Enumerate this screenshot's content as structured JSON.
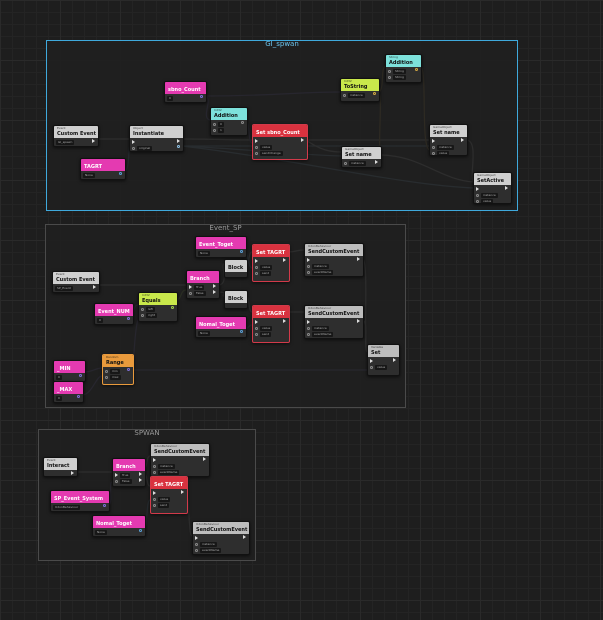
{
  "groups": {
    "gi_spwan": "GI_spwan",
    "event_sp": "Event_SP",
    "spwan": "SPWAN"
  },
  "nodes": {
    "g1_custom_event": {
      "title": "Custom Event",
      "field": "GI_spawn"
    },
    "g1_instantiate": {
      "title": "Instantiate"
    },
    "g1_tagrt": {
      "title": "TAGRT"
    },
    "g1_sbno_count": {
      "title": "sbno_Count"
    },
    "g1_addition_a": {
      "title": "Addition"
    },
    "g1_set_sbno_count": {
      "title": "Set sbno_Count"
    },
    "g1_tostring": {
      "title": "ToString"
    },
    "g1_addition_b": {
      "title": "Addition"
    },
    "g1_set_name_a": {
      "title": "Set name"
    },
    "g1_set_name_b": {
      "title": "Set name"
    },
    "g1_setactive": {
      "title": "SetActive"
    },
    "e_custom_event": {
      "title": "Custom Event",
      "field": "SP_Event"
    },
    "e_event_toget": {
      "title": "Event_Toget"
    },
    "e_set_tagrt_a": {
      "title": "Set TAGRT"
    },
    "e_send_custom_a": {
      "title": "SendCustomEvent"
    },
    "e_branch": {
      "title": "Branch"
    },
    "e_block_a": {
      "title": "Block"
    },
    "e_block_b": {
      "title": "Block"
    },
    "e_event_num": {
      "title": "Event_NUM"
    },
    "e_equals": {
      "title": "Equals"
    },
    "e_nomal_toget": {
      "title": "Nomal_Toget"
    },
    "e_set_tagrt_b": {
      "title": "Set TAGRT"
    },
    "e_send_custom_b": {
      "title": "SendCustomEvent"
    },
    "e_min": {
      "title": "_MIN"
    },
    "e_range": {
      "title": "Range"
    },
    "e_max": {
      "title": "_MAX"
    },
    "e_set": {
      "title": "Set"
    },
    "s_custom_event": {
      "title": "Interact"
    },
    "s_branch": {
      "title": "Branch"
    },
    "s_send_custom_a": {
      "title": "SendCustomEvent"
    },
    "s_sp_event_system": {
      "title": "SP_Event_System"
    },
    "s_set_tagrt": {
      "title": "Set TAGRT"
    },
    "s_nomal_toget": {
      "title": "Nomal_Toget"
    },
    "s_send_custom_b": {
      "title": "SendCustomEvent"
    }
  }
}
